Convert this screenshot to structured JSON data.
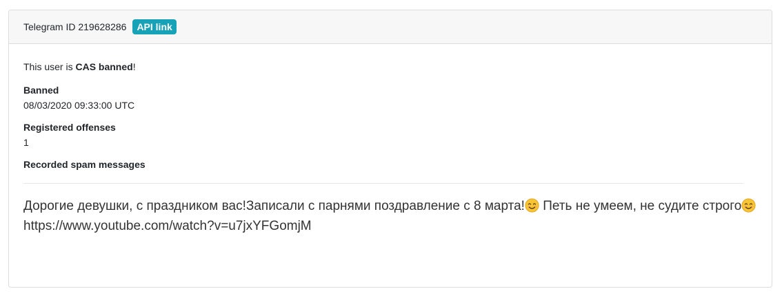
{
  "header": {
    "telegram_id_text": "Telegram ID 219628286",
    "api_link_label": "API link",
    "api_badge_color": "#17a2b8"
  },
  "status": {
    "prefix": "This user is ",
    "highlight": "CAS banned",
    "suffix": "!"
  },
  "fields": {
    "banned_label": "Banned",
    "banned_value": "08/03/2020 09:33:00 UTC",
    "offenses_label": "Registered offenses",
    "offenses_value": "1",
    "spam_label": "Recorded spam messages"
  },
  "message": {
    "part1": "Дорогие девушки, с праздником вас!Записали с парнями поздравление с 8 марта!",
    "part2": " Петь не умеем, не судите строго",
    "url": "https://www.youtube.com/watch?v=u7jxYFGomjM",
    "emoji_icon": "smiling-face-emoji"
  }
}
